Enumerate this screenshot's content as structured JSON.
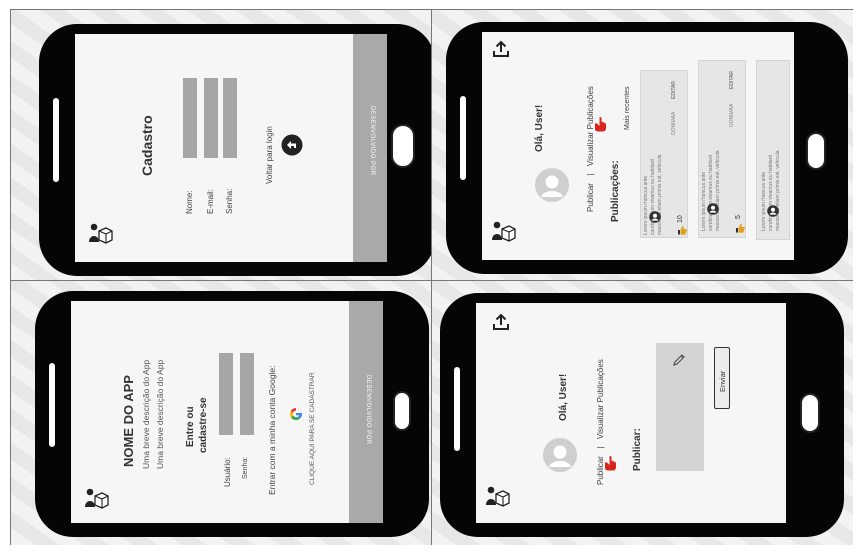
{
  "screens": {
    "cadastro": {
      "title": "Cadastro",
      "fields": [
        "Nome:",
        "E-mail:",
        "Senha:"
      ],
      "back_label": "Voltar para login",
      "footer": "DESENVOLVIDO POR"
    },
    "login": {
      "app_name": "NOME DO APP",
      "description": [
        "Uma breve descrição do App",
        "Uma breve descrição do App"
      ],
      "heading": [
        "Entre ou",
        "cadastre-se"
      ],
      "fields": [
        "Usuário:",
        "Senha:"
      ],
      "google_label": "Entrar com a minha conta Google:",
      "signup_link": "CLIQUE AQUI PARA SE CADASTRAR",
      "footer": "DESENVOLVIDO POR"
    },
    "feed": {
      "greeting": "Olá, User!",
      "nav_publicar": "Publicar",
      "nav_sep": "|",
      "nav_visualizar": "Visualizar Publicações",
      "section": "Publicações:",
      "sort": "Mais recentes",
      "posts": [
        {
          "text": "Lorem ipsum rhoncus ante condimentum vivamus eu habitant maecenas etiam primis est, vehicula",
          "user": "DONIMAA",
          "action": "EDITAR",
          "likes": "10"
        },
        {
          "text": "Lorem ipsum rhoncus ante condimentum vivamus eu habitant maecenas etiam primis est, vehicula",
          "user": "DONIMAA",
          "action": "EDITAR",
          "likes": "5"
        },
        {
          "text": "Lorem ipsum rhoncus ante condimentum vivamus eu habitant maecenas etiam primis est, vehicula",
          "user": "",
          "action": "",
          "likes": ""
        }
      ]
    },
    "publish": {
      "greeting": "Olá, User!",
      "nav_publicar": "Publicar",
      "nav_sep": "|",
      "nav_visualizar": "Visualizar Publicações",
      "section": "Publicar:",
      "send_label": "Enviar"
    }
  },
  "icons": {
    "logo": "person-with-box-logo",
    "upload": "upload-icon",
    "back": "back-arrow-icon",
    "google": "google-icon",
    "pencil": "pencil-icon",
    "pointer": "pointer-hand-icon",
    "avatar": "avatar-icon",
    "like": "thumbs-up-icon"
  },
  "colors": {
    "footer": "#a9a9a9",
    "field": "#a6a6a6",
    "pointer": "#d9261c"
  }
}
